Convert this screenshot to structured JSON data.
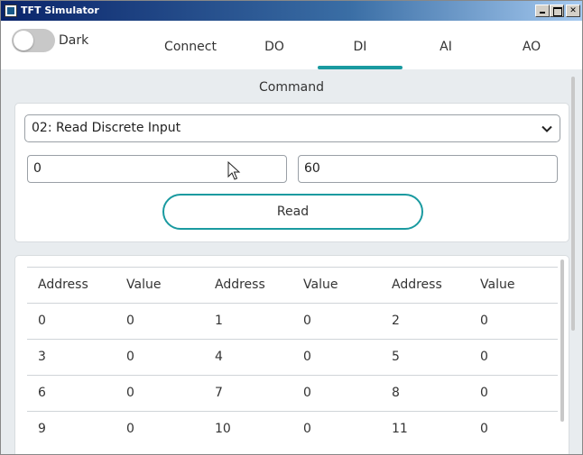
{
  "window": {
    "title": "TFT Simulator"
  },
  "header": {
    "theme_toggle_label": "Dark",
    "tabs": [
      {
        "label": "Connect",
        "active": false
      },
      {
        "label": "DO",
        "active": false
      },
      {
        "label": "DI",
        "active": true
      },
      {
        "label": "AI",
        "active": false
      },
      {
        "label": "AO",
        "active": false
      }
    ]
  },
  "command": {
    "title": "Command",
    "function_select": "02: Read Discrete Input",
    "start_address": "0",
    "quantity": "60",
    "read_label": "Read"
  },
  "table": {
    "headers": [
      "Address",
      "Value",
      "Address",
      "Value",
      "Address",
      "Value"
    ],
    "rows": [
      [
        "0",
        "0",
        "1",
        "0",
        "2",
        "0"
      ],
      [
        "3",
        "0",
        "4",
        "0",
        "5",
        "0"
      ],
      [
        "6",
        "0",
        "7",
        "0",
        "8",
        "0"
      ],
      [
        "9",
        "0",
        "10",
        "0",
        "11",
        "0"
      ]
    ]
  },
  "colors": {
    "accent": "#1a9aa0",
    "background": "#e8ecef"
  }
}
